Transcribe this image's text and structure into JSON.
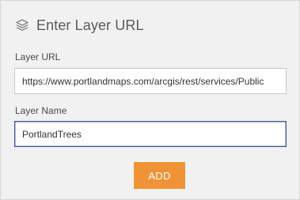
{
  "header": {
    "title": "Enter Layer URL",
    "icon": "layers-icon"
  },
  "form": {
    "url_label": "Layer URL",
    "url_value": "https://www.portlandmaps.com/arcgis/rest/services/Public",
    "name_label": "Layer Name",
    "name_value": "PortlandTrees"
  },
  "actions": {
    "add_label": "ADD"
  },
  "colors": {
    "panel_bg": "#f1f1f1",
    "accent_button": "#ee9436",
    "focused_border": "#3b5998"
  }
}
